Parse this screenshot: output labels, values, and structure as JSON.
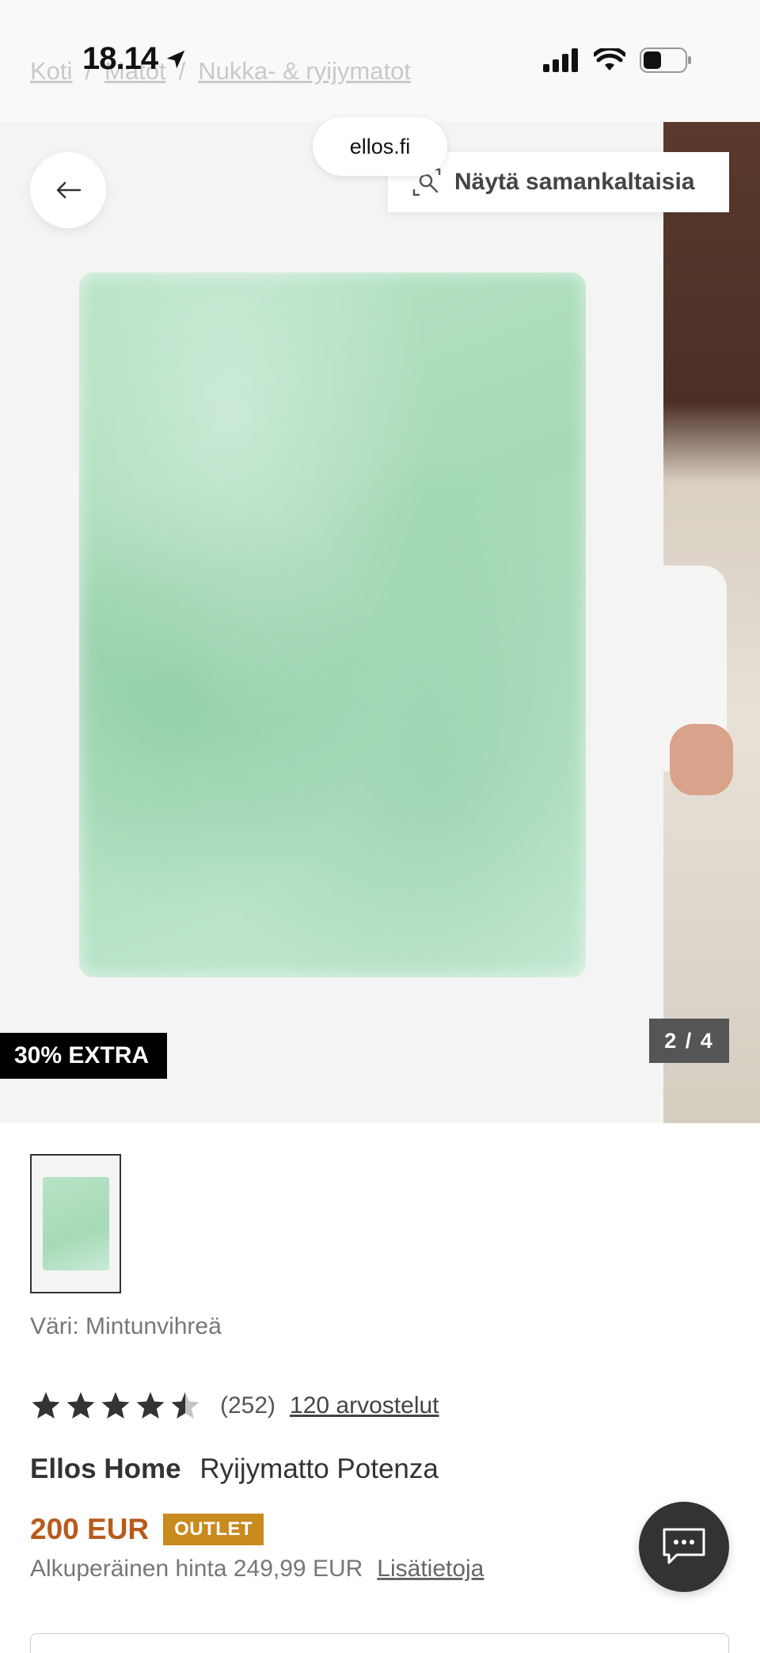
{
  "status_bar": {
    "time": "18.14"
  },
  "breadcrumb": {
    "items": [
      "Koti",
      "Matot",
      "Nukka- & ryijymatot"
    ],
    "separator": "/"
  },
  "browser": {
    "site": "ellos.fi"
  },
  "gallery": {
    "similar_label": "Näytä samankaltaisia",
    "promo_badge": "30% EXTRA",
    "counter": "2 / 4"
  },
  "product": {
    "color_line": "Väri: Mintunvihreä",
    "rating": 4.5,
    "rating_count": "(252)",
    "reviews_link": "120 arvostelut",
    "brand": "Ellos Home",
    "name": "Ryijymatto Potenza",
    "price": "200 EUR",
    "badge": "OUTLET",
    "original_price": "Alkuperäinen hinta 249,99 EUR",
    "more_info": "Lisätietoja"
  },
  "colors": {
    "price": "#b85a1c",
    "outlet_badge": "#c98a1e",
    "rug_mint": "#b3e1c4"
  },
  "icons": [
    "location-arrow-icon",
    "signal-icon",
    "wifi-icon",
    "battery-icon",
    "back-arrow-icon",
    "visual-search-icon",
    "star-icon",
    "chat-icon"
  ]
}
